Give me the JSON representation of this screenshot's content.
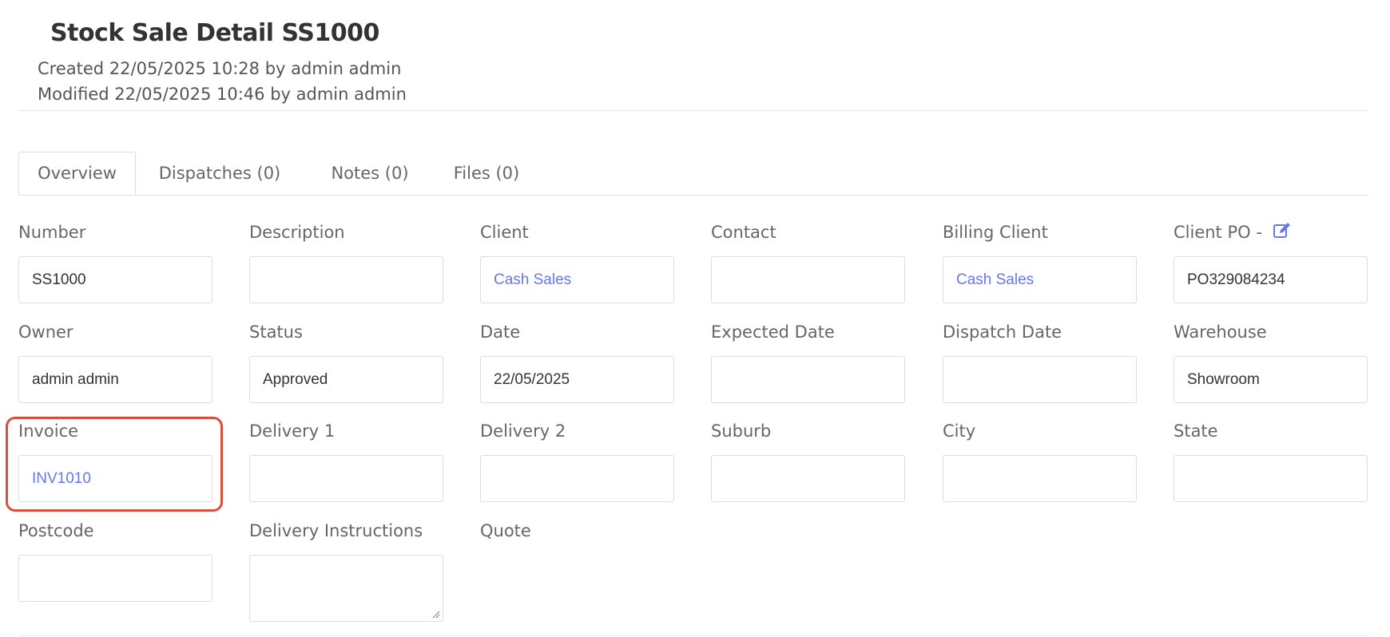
{
  "header": {
    "title": "Stock Sale Detail SS1000",
    "created": "Created 22/05/2025 10:28 by admin admin",
    "modified": "Modified 22/05/2025 10:46 by admin admin"
  },
  "tabs": [
    {
      "label": "Overview",
      "active": true
    },
    {
      "label": "Dispatches (0)",
      "active": false
    },
    {
      "label": "Notes (0)",
      "active": false
    },
    {
      "label": "Files (0)",
      "active": false
    }
  ],
  "fields": {
    "number": {
      "label": "Number",
      "value": "SS1000"
    },
    "description": {
      "label": "Description",
      "value": ""
    },
    "client": {
      "label": "Client",
      "value": "Cash Sales"
    },
    "contact": {
      "label": "Contact",
      "value": ""
    },
    "billing_client": {
      "label": "Billing Client",
      "value": "Cash Sales"
    },
    "client_po": {
      "label": "Client PO -",
      "value": "PO329084234"
    },
    "owner": {
      "label": "Owner",
      "value": "admin admin"
    },
    "status": {
      "label": "Status",
      "value": "Approved"
    },
    "date": {
      "label": "Date",
      "value": "22/05/2025"
    },
    "expected_date": {
      "label": "Expected Date",
      "value": ""
    },
    "dispatch_date": {
      "label": "Dispatch Date",
      "value": ""
    },
    "warehouse": {
      "label": "Warehouse",
      "value": "Showroom"
    },
    "invoice": {
      "label": "Invoice",
      "value": "INV1010"
    },
    "delivery1": {
      "label": "Delivery 1",
      "value": ""
    },
    "delivery2": {
      "label": "Delivery 2",
      "value": ""
    },
    "suburb": {
      "label": "Suburb",
      "value": ""
    },
    "city": {
      "label": "City",
      "value": ""
    },
    "state": {
      "label": "State",
      "value": ""
    },
    "postcode": {
      "label": "Postcode",
      "value": ""
    },
    "delivery_instructions": {
      "label": "Delivery Instructions",
      "value": ""
    },
    "quote": {
      "label": "Quote"
    }
  },
  "icons": {
    "client_po_edit": "edit-icon"
  },
  "colors": {
    "link": "#6777ef",
    "highlight": "#d9503a"
  }
}
